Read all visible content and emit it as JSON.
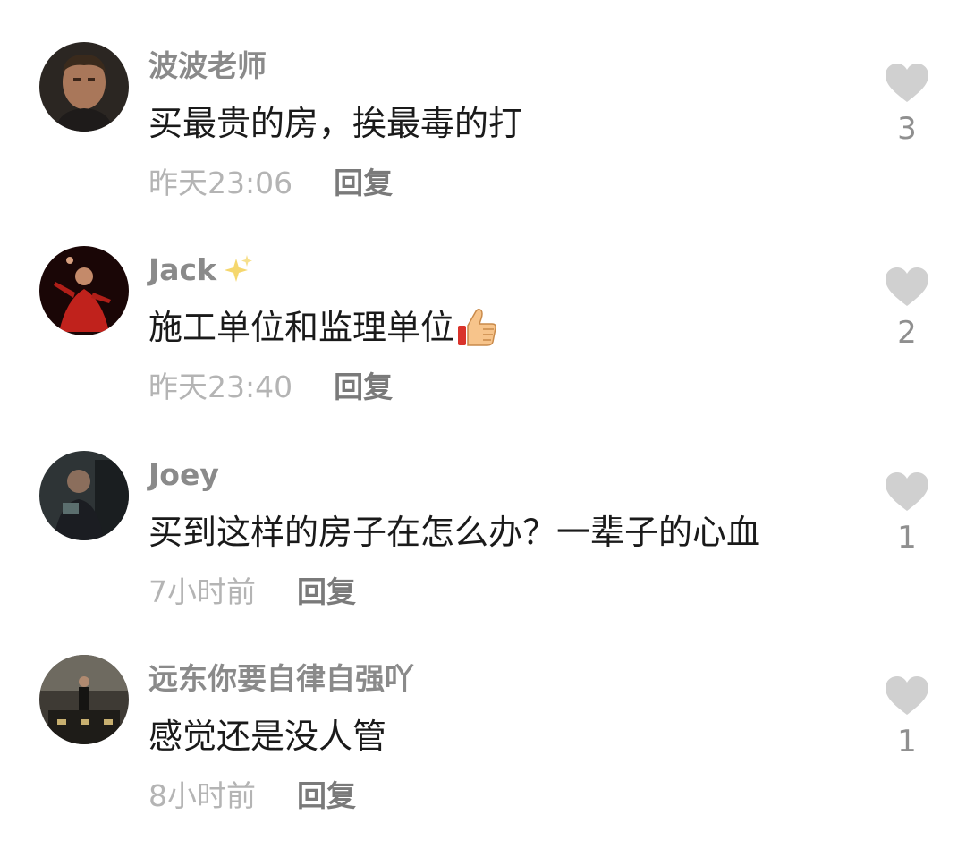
{
  "comments": [
    {
      "username": "波波老师",
      "text": "买最贵的房，挨最毒的打",
      "time": "昨天23:06",
      "reply_label": "回复",
      "likes": "3"
    },
    {
      "username": "Jack",
      "username_icon": "sparkle-icon",
      "text": "施工单位和监理单位",
      "text_icon": "thumbs-up-icon",
      "time": "昨天23:40",
      "reply_label": "回复",
      "likes": "2"
    },
    {
      "username": "Joey",
      "text": "买到这样的房子在怎么办？一辈子的心血",
      "time": "7小时前",
      "reply_label": "回复",
      "likes": "1"
    },
    {
      "username": "远东你要自律自强吖",
      "text": "感觉还是没人管",
      "time": "8小时前",
      "reply_label": "回复",
      "likes": "1"
    }
  ],
  "colors": {
    "username": "#8a8a8a",
    "text": "#1a1a1a",
    "timestamp": "#b4b4b4",
    "reply": "#7a7a7a",
    "heart": "#d0d0d0",
    "like_count": "#8f8f8f"
  }
}
